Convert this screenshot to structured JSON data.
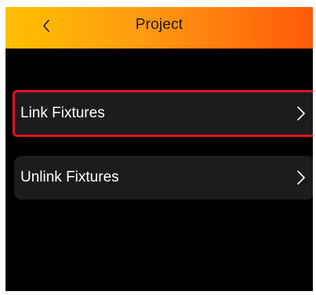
{
  "header": {
    "title": "Project",
    "back_icon": "chevron-left-icon"
  },
  "menu": {
    "items": [
      {
        "label": "Link Fixtures",
        "icon": "chevron-right-icon",
        "highlighted": true
      },
      {
        "label": "Unlink Fixtures",
        "icon": "chevron-right-icon",
        "highlighted": false
      }
    ]
  },
  "colors": {
    "header_gradient_start": "#ffc000",
    "header_gradient_end": "#ff5a08",
    "background": "#000000",
    "item_background": "#1c1c1e",
    "highlight_border": "#e1141b",
    "text": "#ffffff"
  }
}
